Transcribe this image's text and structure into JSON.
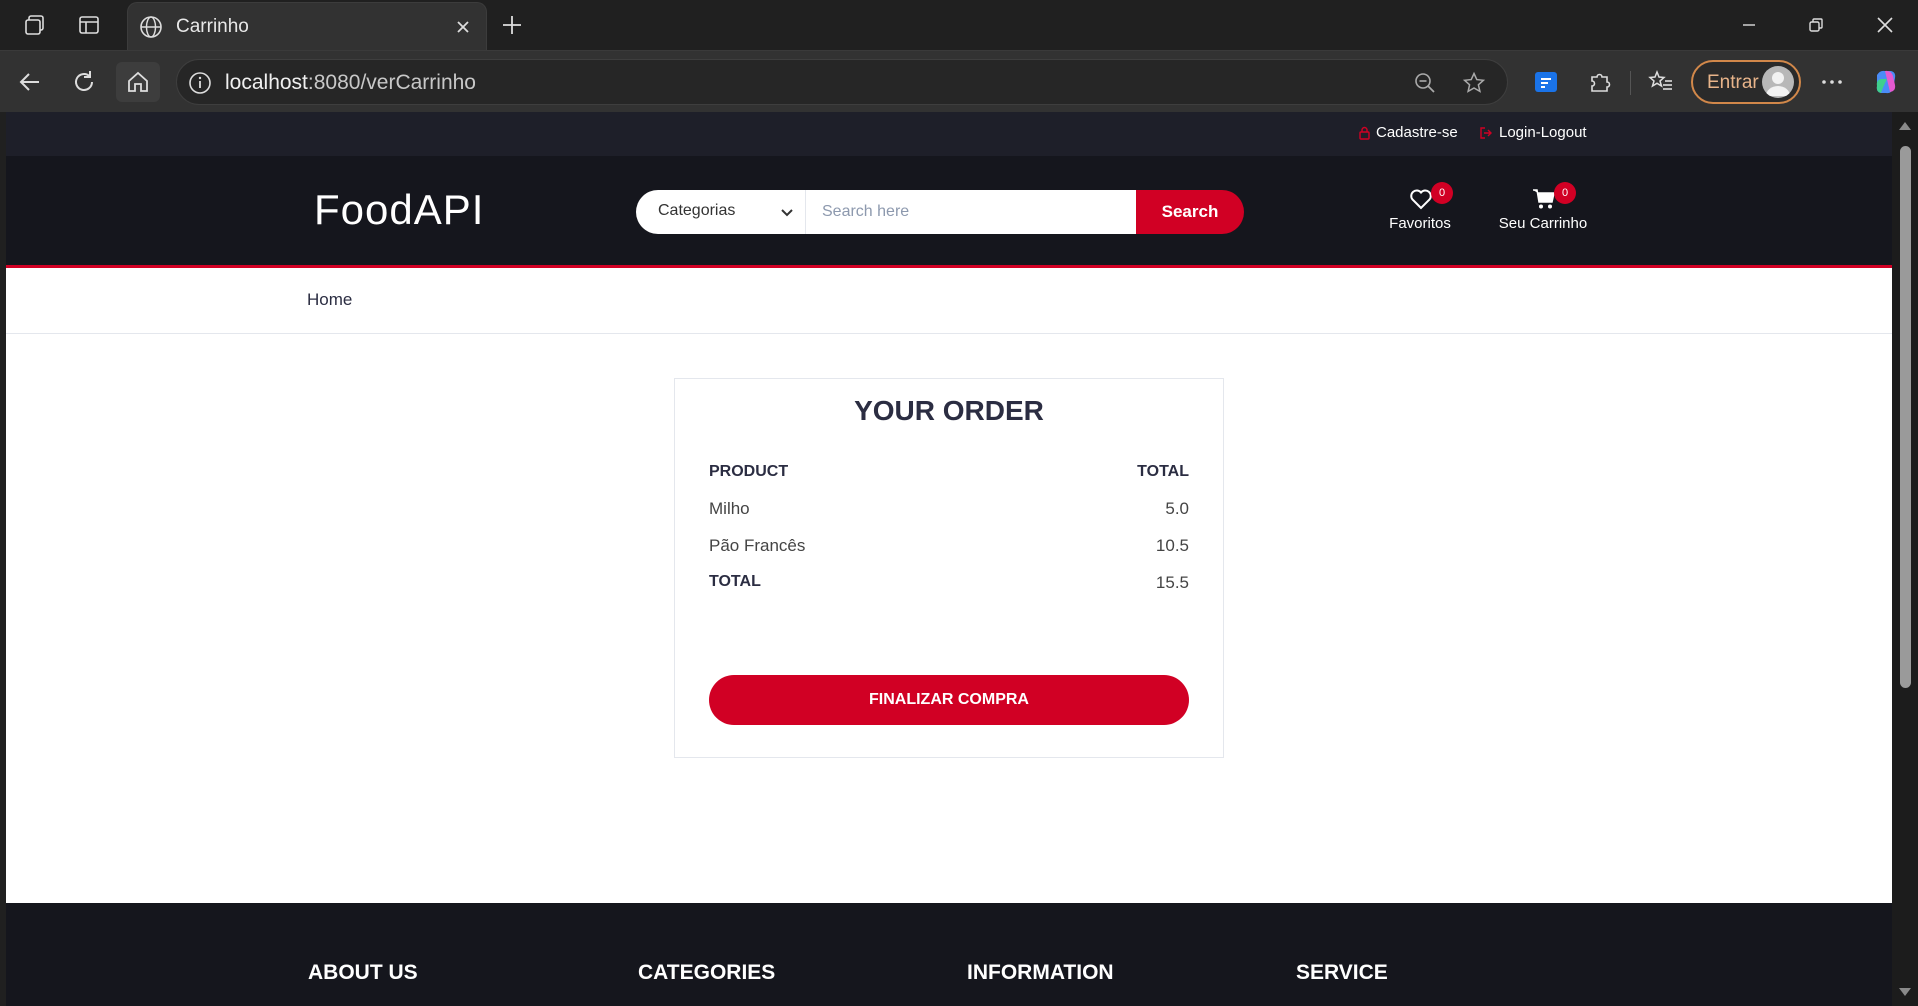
{
  "browser": {
    "tab_title": "Carrinho",
    "url_host": "localhost",
    "url_rest": ":8080/verCarrinho",
    "profile_label": "Entrar"
  },
  "top_links": {
    "register": "Cadastre-se",
    "login": "Login-Logout"
  },
  "header": {
    "logo": "FoodAPI",
    "category_selected": "Categorias",
    "search_placeholder": "Search here",
    "search_button": "Search",
    "favorites_label": "Favoritos",
    "favorites_count": "0",
    "cart_label": "Seu Carrinho",
    "cart_count": "0"
  },
  "breadcrumb": {
    "home": "Home"
  },
  "order": {
    "title": "YOUR ORDER",
    "col_product": "PRODUCT",
    "col_total": "TOTAL",
    "items": [
      {
        "name": "Milho",
        "total": "5.0"
      },
      {
        "name": "Pão Francês",
        "total": "10.5"
      }
    ],
    "total_label": "TOTAL",
    "total_value": "15.5",
    "checkout_button": "FINALIZAR COMPRA"
  },
  "footer": {
    "headings": [
      "ABOUT US",
      "CATEGORIES",
      "INFORMATION",
      "SERVICE"
    ]
  },
  "colors": {
    "accent": "#d10024",
    "header_dark": "#15161d",
    "top_bar": "#1e1f29"
  }
}
